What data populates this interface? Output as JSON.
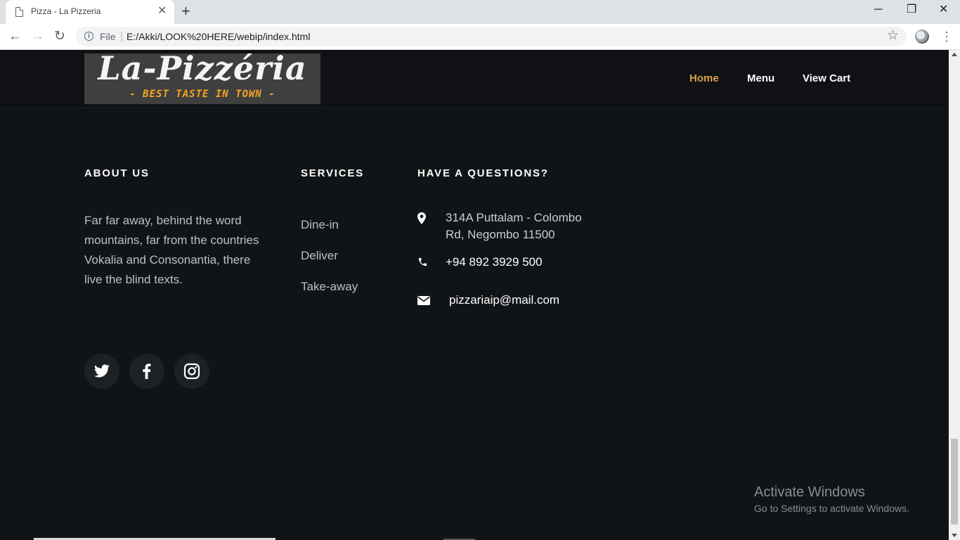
{
  "browser": {
    "tab_title": "Pizza - La Pizzeria",
    "close_tab_glyph": "✕",
    "new_tab_glyph": "+",
    "file_label": "File",
    "url": "E:/Akki/LOOK%20HERE/webip/index.html",
    "window_controls": [
      "─",
      "❐",
      "✕"
    ]
  },
  "navbar": {
    "logo_title": "La-Pizzéria",
    "logo_tagline": "- BEST TASTE IN TOWN -",
    "links": [
      {
        "label": "Home",
        "active": true
      },
      {
        "label": "Menu",
        "active": false
      },
      {
        "label": "View Cart",
        "active": false
      }
    ]
  },
  "footer": {
    "about": {
      "heading": "ABOUT US",
      "text": "Far far away, behind the word mountains, far from the countries Vokalia and Consonantia, there live the blind texts."
    },
    "services": {
      "heading": "SERVICES",
      "items": [
        "Dine-in",
        "Deliver",
        "Take-away"
      ]
    },
    "contact": {
      "heading": "HAVE A QUESTIONS?",
      "address": "314A Puttalam - Colombo Rd, Negombo 11500",
      "phone": "+94 892 3929 500",
      "email": "pizzariaip@mail.com"
    },
    "social": [
      "twitter-icon",
      "facebook-icon",
      "instagram-icon"
    ]
  },
  "os_watermark": {
    "title": "Activate Windows",
    "subtitle": "Go to Settings to activate Windows."
  },
  "colors": {
    "background": "#111417",
    "accent": "#d9a04a",
    "logo_tagline": "#f5a623"
  }
}
